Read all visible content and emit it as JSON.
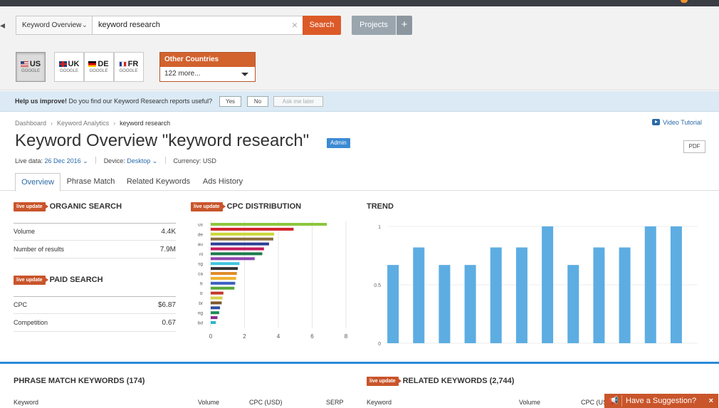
{
  "search": {
    "db_selector": "Keyword Overview",
    "query": "keyword research",
    "button": "Search",
    "projects": "Projects",
    "projects_add": "+"
  },
  "countries": {
    "items": [
      {
        "code": "US",
        "engine": "GOOGLE",
        "selected": true
      },
      {
        "code": "UK",
        "engine": "GOOGLE",
        "selected": false
      },
      {
        "code": "DE",
        "engine": "GOOGLE",
        "selected": false
      },
      {
        "code": "FR",
        "engine": "GOOGLE",
        "selected": false
      }
    ],
    "other_title": "Other Countries",
    "other_value": "122 more..."
  },
  "feedback": {
    "bold": "Help us improve!",
    "text": "Do you find our Keyword Research reports useful?",
    "yes": "Yes",
    "no": "No",
    "later": "Ask me later"
  },
  "breadcrumb": [
    "Dashboard",
    "Keyword Analytics",
    "keyword research"
  ],
  "video_tutorial": "Video Tutorial",
  "header": {
    "title": "Keyword Overview \"keyword research\"",
    "badge": "Admin",
    "pdf": "PDF",
    "live_label": "Live data:",
    "live_date": "26 Dec 2016",
    "device_label": "Device:",
    "device": "Desktop",
    "currency": "Currency: USD"
  },
  "tabs": [
    "Overview",
    "Phrase Match",
    "Related Keywords",
    "Ads History"
  ],
  "live_badge": "live update",
  "organic": {
    "title": "ORGANIC SEARCH",
    "rows": [
      {
        "label": "Volume",
        "value": "4.4K"
      },
      {
        "label": "Number of results",
        "value": "7.9M"
      }
    ]
  },
  "paid": {
    "title": "PAID SEARCH",
    "rows": [
      {
        "label": "CPC",
        "value": "$6.87"
      },
      {
        "label": "Competition",
        "value": "0.67"
      }
    ]
  },
  "chart_data": [
    {
      "type": "bar",
      "orientation": "horizontal",
      "title": "CPC DISTRIBUTION",
      "categories": [
        "us",
        "",
        "de",
        "",
        "au",
        "",
        "nl",
        "",
        "sg",
        "",
        "ca",
        "",
        "fr",
        "",
        "tr",
        "",
        "br",
        "",
        "ng",
        "",
        "bd"
      ],
      "values": [
        6.87,
        4.9,
        3.75,
        3.7,
        3.45,
        3.15,
        3.05,
        2.6,
        1.7,
        1.6,
        1.55,
        1.5,
        1.45,
        1.4,
        0.75,
        0.7,
        0.65,
        0.55,
        0.5,
        0.4,
        0.3
      ],
      "colors": [
        "#8dc63f",
        "#d2232a",
        "#c9d737",
        "#8a6d3b",
        "#2c3e94",
        "#c2185b",
        "#1b7a4a",
        "#8e44ad",
        "#3ec6e0",
        "#333333",
        "#e08b2a",
        "#f0b030",
        "#3a5fc0",
        "#57a639",
        "#c0392b",
        "#d4d24a",
        "#7a5a2a",
        "#2f4ea0",
        "#1d8a55",
        "#8b2a8b",
        "#2bb6c9"
      ],
      "x_ticks": [
        0,
        2,
        4,
        6,
        8
      ],
      "xlim": [
        0,
        8
      ],
      "grid": true
    },
    {
      "type": "bar",
      "title": "TREND",
      "values": [
        0.67,
        0.82,
        0.67,
        0.67,
        0.82,
        0.82,
        1,
        0.67,
        0.82,
        0.82,
        1,
        1
      ],
      "y_ticks": [
        0,
        0.5,
        1
      ],
      "ylim": [
        0,
        1
      ],
      "color": "#5dade2",
      "grid": true
    }
  ],
  "phrase_match": {
    "title": "PHRASE MATCH KEYWORDS (174)",
    "columns": [
      "Keyword",
      "Volume",
      "CPC (USD)",
      "SERP"
    ]
  },
  "related": {
    "title": "RELATED KEYWORDS (2,744)",
    "columns": [
      "Keyword",
      "Volume",
      "CPC (US"
    ]
  },
  "suggestion": {
    "label": "Have a Suggestion?",
    "close": "×",
    "icon": "megaphone-icon"
  }
}
